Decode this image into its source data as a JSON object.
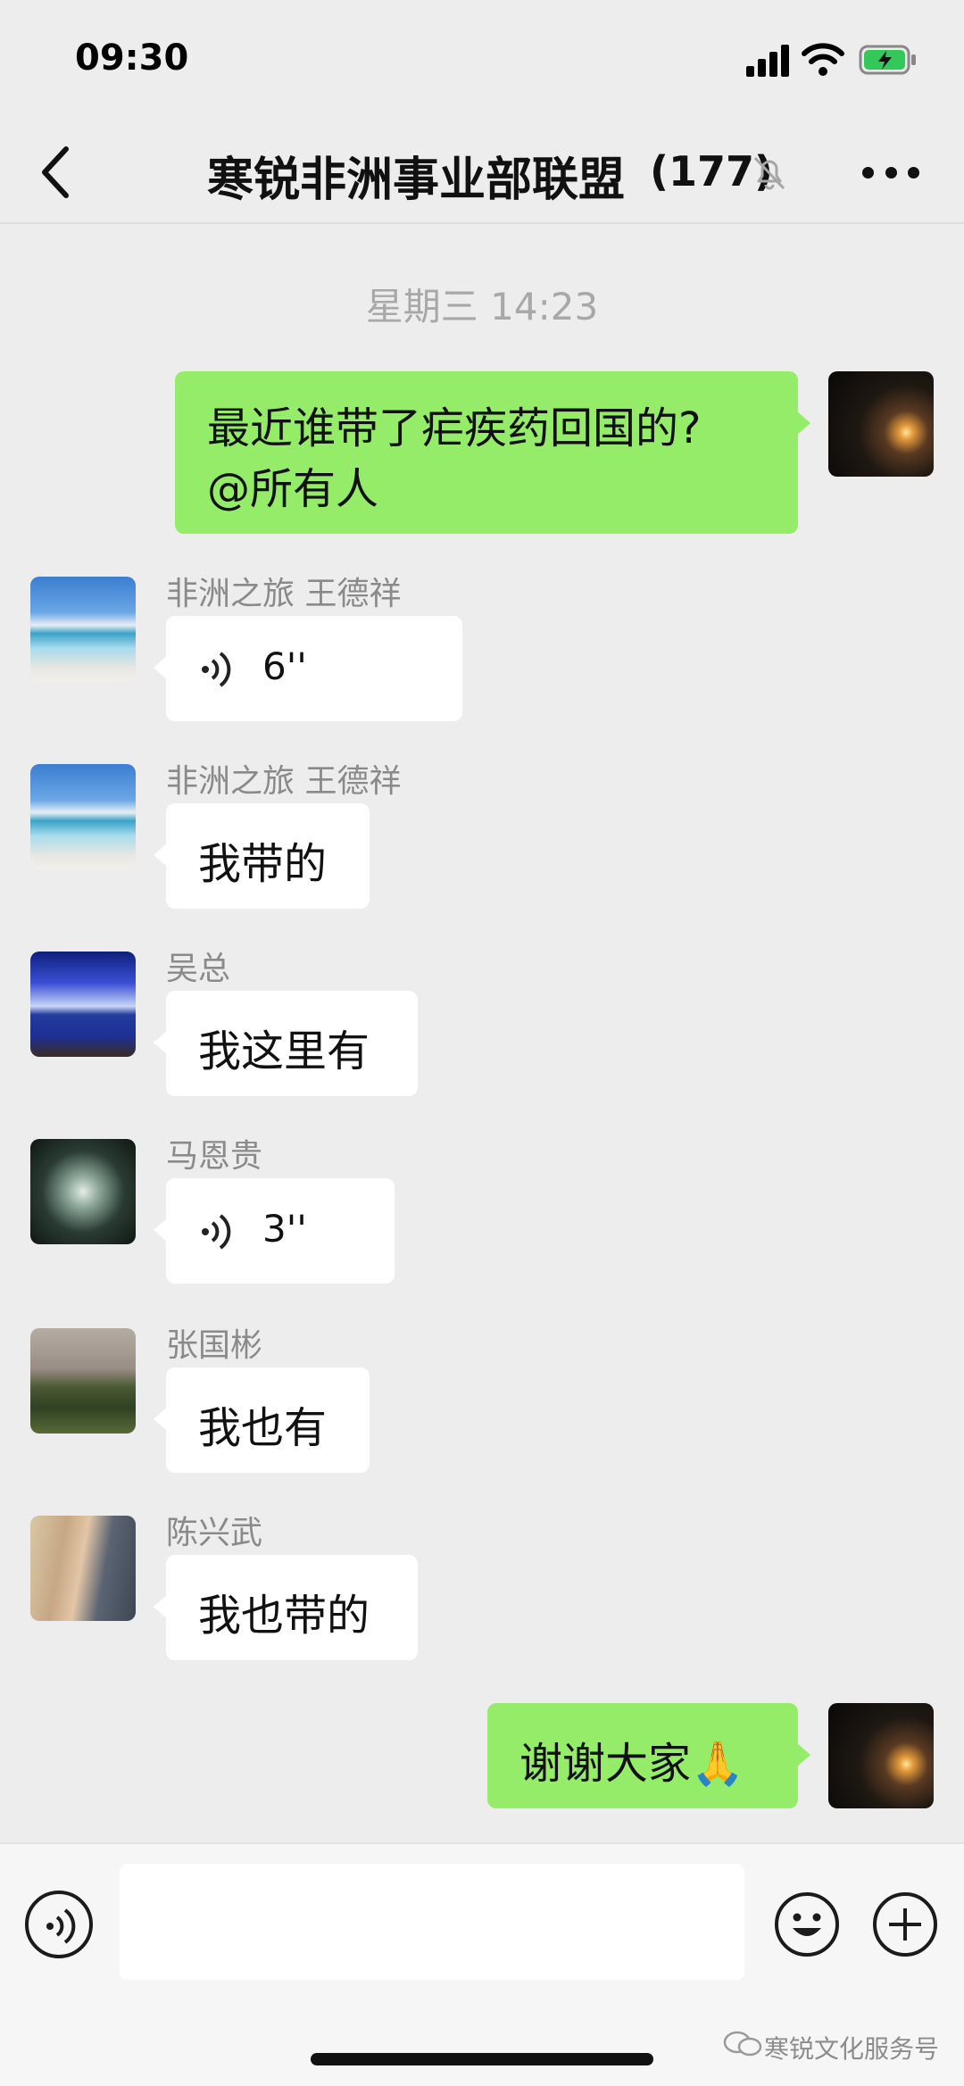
{
  "status_bar": {
    "time": "09:30"
  },
  "header": {
    "title": "寒锐非洲事业部联盟",
    "member_count": "(177)"
  },
  "timestamp": "星期三 14:23",
  "messages": [
    {
      "type": "text",
      "side": "right",
      "text_lines": [
        "最近谁带了疟疾药回国的?",
        "@所有人"
      ]
    },
    {
      "type": "voice",
      "side": "left",
      "sender": "非洲之旅 王德祥",
      "duration": "6''"
    },
    {
      "type": "text",
      "side": "left",
      "sender": "非洲之旅 王德祥",
      "text": "我带的"
    },
    {
      "type": "text",
      "side": "left",
      "sender": "吴总",
      "text": "我这里有"
    },
    {
      "type": "voice",
      "side": "left",
      "sender": "马恩贵",
      "duration": "3''"
    },
    {
      "type": "text",
      "side": "left",
      "sender": "张国彬",
      "text": "我也有"
    },
    {
      "type": "text",
      "side": "left",
      "sender": "陈兴武",
      "text": "我也带的"
    },
    {
      "type": "text",
      "side": "right",
      "text": "谢谢大家🙏"
    }
  ],
  "input_bar": {
    "placeholder": ""
  },
  "watermark": "寒锐文化服务号",
  "colors": {
    "background": "#ededed",
    "self_bubble": "#95ec69",
    "other_bubble": "#ffffff",
    "battery_green": "#34c759"
  },
  "icons": [
    "signal-icon",
    "wifi-icon",
    "battery-icon",
    "back-icon",
    "mute-bell-icon",
    "more-icon",
    "voice-icon",
    "emoji-icon",
    "add-icon",
    "wechat-icon"
  ]
}
